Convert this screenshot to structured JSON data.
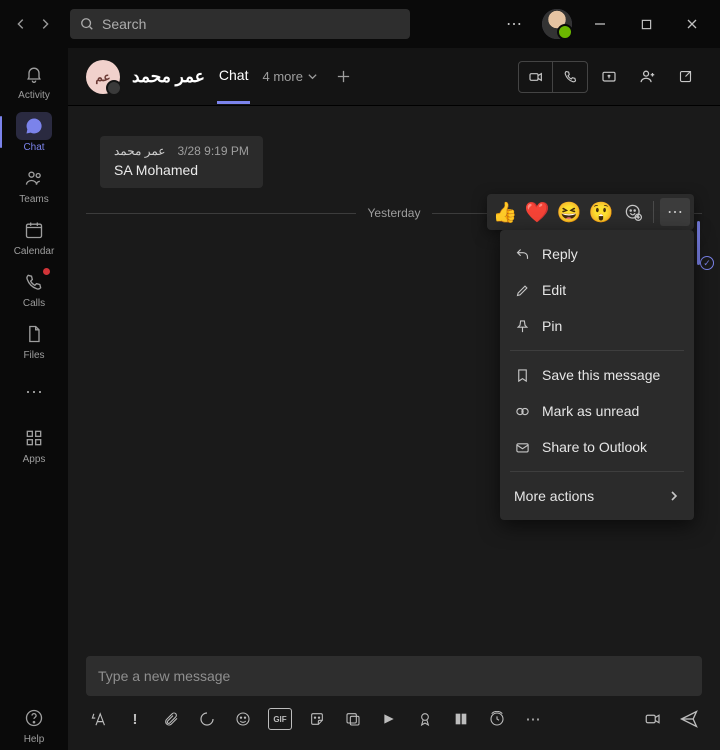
{
  "search": {
    "placeholder": "Search"
  },
  "rail": {
    "activity": "Activity",
    "chat": "Chat",
    "teams": "Teams",
    "calendar": "Calendar",
    "calls": "Calls",
    "files": "Files",
    "apps": "Apps",
    "help": "Help"
  },
  "chatHeader": {
    "avatarInitials": "عم",
    "name": "عمر محمد",
    "tab": "Chat",
    "moreTabs": "4 more"
  },
  "message": {
    "author": "عمر محمد",
    "time": "3/28 9:19 PM",
    "body": "SA Mohamed"
  },
  "divider": "Yesterday",
  "reactions": {
    "like": "👍",
    "heart": "❤️",
    "laugh": "😆",
    "surprised": "😲"
  },
  "menu": {
    "reply": "Reply",
    "edit": "Edit",
    "pin": "Pin",
    "save": "Save this message",
    "unread": "Mark as unread",
    "share": "Share to Outlook",
    "more": "More actions"
  },
  "compose": {
    "placeholder": "Type a new message"
  },
  "composeIcons": {
    "format": "format-icon",
    "priority": "priority-icon",
    "attach": "attach-icon",
    "loop": "loop-icon",
    "emoji": "emoji-icon",
    "gif": "gif-icon",
    "sticker": "sticker-icon",
    "actions": "actions-icon",
    "stream": "stream-icon",
    "approvals": "approvals-icon",
    "viva": "viva-icon",
    "schedule": "schedule-icon",
    "more": "more-icon",
    "meet": "meet-icon",
    "send": "send-icon"
  }
}
